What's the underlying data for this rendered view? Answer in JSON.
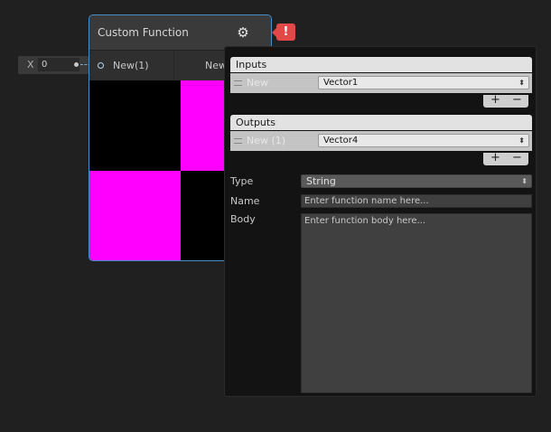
{
  "port_input": {
    "axis_label": "X",
    "value": "0"
  },
  "node": {
    "title": "Custom Function",
    "input_port_label": "New(1)",
    "output_port_label": "New",
    "preview_colors": {
      "magenta": "#ff00ff",
      "black": "#000000"
    }
  },
  "error_badge": {
    "symbol": "!"
  },
  "inspector": {
    "inputs": {
      "header": "Inputs",
      "rows": [
        {
          "name": "New",
          "type": "Vector1"
        }
      ]
    },
    "outputs": {
      "header": "Outputs",
      "rows": [
        {
          "name": "New (1)",
          "type": "Vector4"
        }
      ]
    },
    "add_symbol": "+",
    "remove_symbol": "−",
    "type_label": "Type",
    "type_value": "String",
    "name_label": "Name",
    "name_placeholder": "Enter function name here...",
    "body_label": "Body",
    "body_placeholder": "Enter function body here..."
  },
  "icons": {
    "gear": "gear-icon",
    "handle": "drag-handle-icon",
    "dropdown": "dropdown-arrows-icon",
    "port": "port-ring-icon"
  }
}
